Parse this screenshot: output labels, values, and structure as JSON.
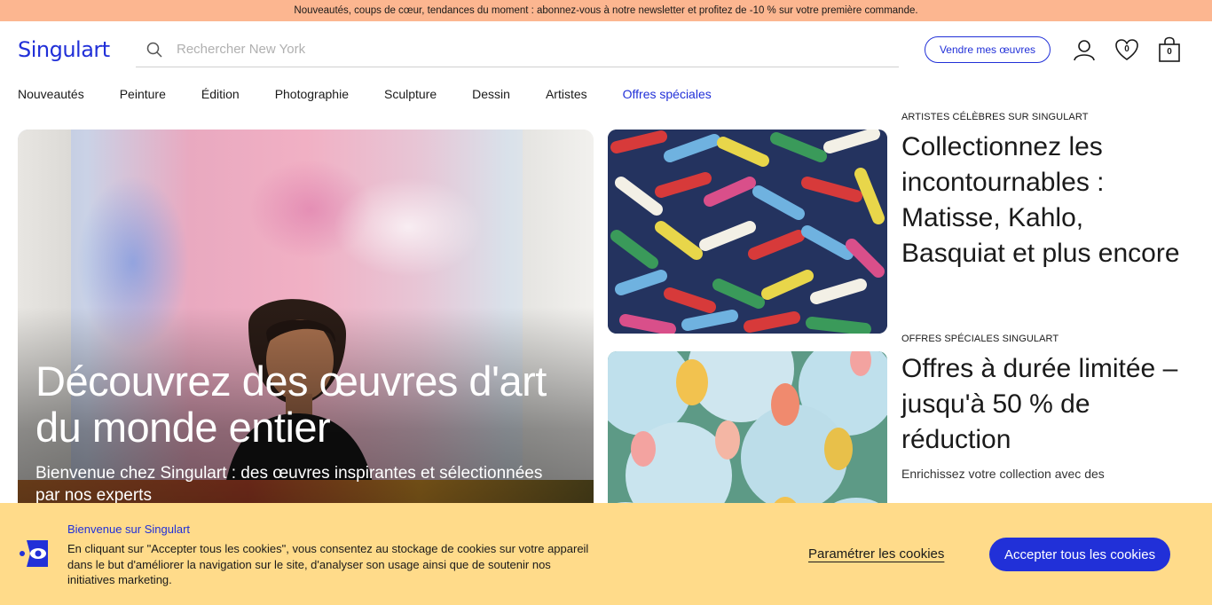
{
  "promo_bar": {
    "text": "Nouveautés, coups de cœur, tendances du moment : abonnez-vous à notre newsletter et profitez de -10 % sur votre première commande."
  },
  "header": {
    "logo": "Singulart",
    "search": {
      "placeholder": "Rechercher New York",
      "value": ""
    },
    "sell_label": "Vendre mes œuvres",
    "wishlist_count": "0",
    "cart_count": "0"
  },
  "nav": {
    "items": [
      {
        "label": "Nouveautés"
      },
      {
        "label": "Peinture"
      },
      {
        "label": "Édition"
      },
      {
        "label": "Photographie"
      },
      {
        "label": "Sculpture"
      },
      {
        "label": "Dessin"
      },
      {
        "label": "Artistes"
      },
      {
        "label": "Offres spéciales",
        "accent": true
      }
    ]
  },
  "hero": {
    "title": "Découvrez des œuvres d'art du monde entier",
    "subtitle": "Bienvenue chez Singulart : des œuvres inspirantes et sélectionnées par nos experts"
  },
  "cards": [
    {
      "eyebrow": "ARTISTES CÉLÈBRES SUR SINGULART",
      "title": "Collectionnez les incontournables : Matisse, Kahlo, Basquiat et plus encore",
      "description": ""
    },
    {
      "eyebrow": "OFFRES SPÉCIALES SINGULART",
      "title": "Offres à durée limitée – jusqu'à 50 % de réduction",
      "description": "Enrichissez votre collection avec des"
    }
  ],
  "cookie_banner": {
    "title": "Bienvenue sur Singulart",
    "text": "En cliquant sur \"Accepter tous les cookies\", vous consentez au stockage de cookies sur votre appareil dans le but d'améliorer la navigation sur le site, d'analyser son usage ainsi que de soutenir nos initiatives marketing.",
    "settings_label": "Paramétrer les cookies",
    "accept_label": "Accepter tous les cookies"
  },
  "colors": {
    "brand": "#2130d8",
    "promo_bg": "#fcb690",
    "cookie_bg": "#ffdb8a"
  }
}
